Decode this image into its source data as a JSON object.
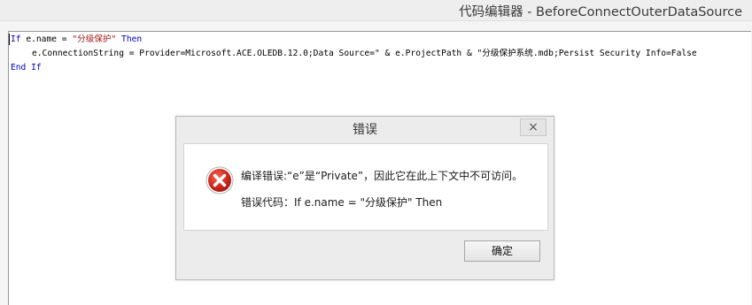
{
  "window": {
    "title": "代码编辑器 - BeforeConnectOuterDataSource"
  },
  "code": {
    "line1": {
      "kw1": "If",
      "mid": " e.name = ",
      "str": "\"分级保护\"",
      "kw2": " Then"
    },
    "line2": {
      "text": "e.ConnectionString = Provider=Microsoft.ACE.OLEDB.12.0;Data Source=\" & e.ProjectPath & \"分级保护系统.mdb;Persist Security Info=False"
    },
    "line3": {
      "kw": "End If"
    }
  },
  "dialog": {
    "title": "错误",
    "close_label": "×",
    "message": "编译错误:“e”是“Private”，因此它在此上下文中不可访问。",
    "error_code": "错误代码：If e.name = \"分级保护\" Then",
    "ok_label": "确定",
    "icon": "error-icon",
    "icon_color": "#c42b1c"
  }
}
